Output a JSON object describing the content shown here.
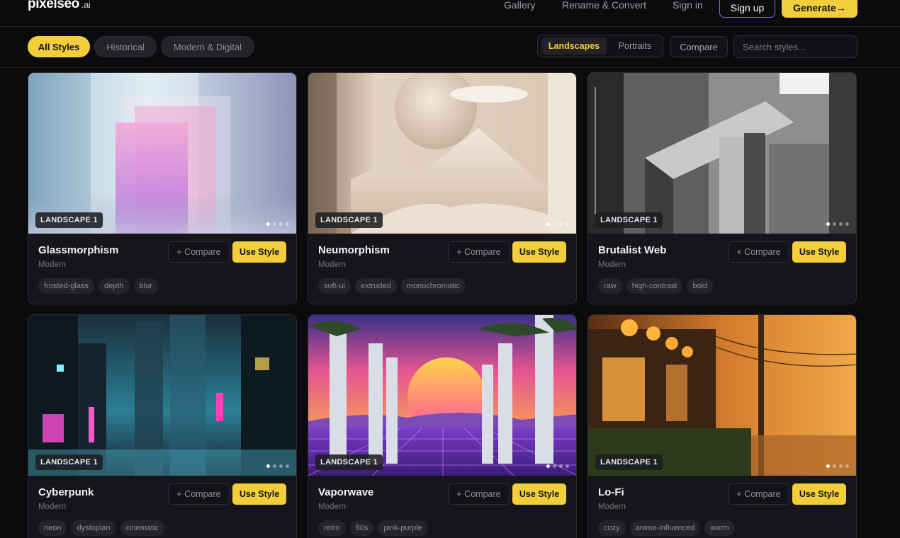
{
  "header": {
    "logo_text": "pixelseo",
    "logo_suffix": ".ai",
    "nav": [
      "Gallery",
      "Rename & Convert",
      "Sign in"
    ],
    "signup_label": "Sign up",
    "generate_label": "Generate→"
  },
  "filters": {
    "categories": [
      "All Styles",
      "Historical",
      "Modern & Digital"
    ],
    "active_category": "All Styles",
    "orientation": [
      "Landscapes",
      "Portraits"
    ],
    "active_orientation": "Landscapes",
    "compare_label": "Compare",
    "search_placeholder": "Search styles..."
  },
  "cards": [
    {
      "title": "Glassmorphism",
      "category": "Modern",
      "badge": "LANDSCAPE 1",
      "compare_label": "+ Compare",
      "use_label": "Use Style",
      "tags": [
        "frosted-glass",
        "depth",
        "blur"
      ],
      "image": "glass-panels-image"
    },
    {
      "title": "Neumorphism",
      "category": "Modern",
      "badge": "LANDSCAPE 1",
      "compare_label": "+ Compare",
      "use_label": "Use Style",
      "tags": [
        "soft-ui",
        "extruded",
        "monochromatic"
      ],
      "image": "soft-sculpture-image"
    },
    {
      "title": "Brutalist Web",
      "category": "Modern",
      "badge": "LANDSCAPE 1",
      "compare_label": "+ Compare",
      "use_label": "Use Style",
      "tags": [
        "raw",
        "high-contrast",
        "bold"
      ],
      "image": "concrete-building-image"
    },
    {
      "title": "Cyberpunk",
      "category": "Modern",
      "badge": "LANDSCAPE 1",
      "compare_label": "+ Compare",
      "use_label": "Use Style",
      "tags": [
        "neon",
        "dystopian",
        "cinematic"
      ],
      "image": "neon-city-image"
    },
    {
      "title": "Vaporwave",
      "category": "Modern",
      "badge": "LANDSCAPE 1",
      "compare_label": "+ Compare",
      "use_label": "Use Style",
      "tags": [
        "retro",
        "80s",
        "pink-purple"
      ],
      "image": "sunset-columns-image"
    },
    {
      "title": "Lo-Fi",
      "category": "Modern",
      "badge": "LANDSCAPE 1",
      "compare_label": "+ Compare",
      "use_label": "Use Style",
      "tags": [
        "cozy",
        "anime-influenced",
        "warm"
      ],
      "image": "lantern-street-image"
    }
  ],
  "colors": {
    "accent": "#f2cf3a",
    "signup_border": "#7c6cf0",
    "background": "#0b0b0e",
    "card": "#15151a"
  }
}
